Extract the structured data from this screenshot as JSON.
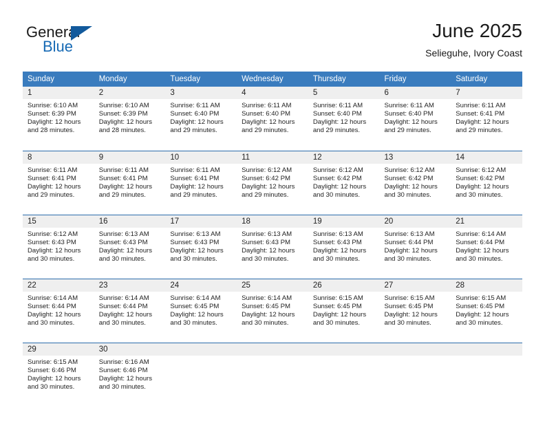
{
  "brand": {
    "name_part1": "General",
    "name_part2": "Blue",
    "triangle_color": "#125a9c",
    "blue_color": "#1569b4"
  },
  "header": {
    "title": "June 2025",
    "subtitle": "Selieguhe, Ivory Coast"
  },
  "colors": {
    "header_bg": "#3a7cbe",
    "daynum_bg": "#efefef",
    "row_divider": "#2b6cab",
    "text": "#222222"
  },
  "weekday_headers": [
    "Sunday",
    "Monday",
    "Tuesday",
    "Wednesday",
    "Thursday",
    "Friday",
    "Saturday"
  ],
  "weeks": [
    [
      {
        "day": "1",
        "sunrise": "Sunrise: 6:10 AM",
        "sunset": "Sunset: 6:39 PM",
        "daylight_line1": "Daylight: 12 hours",
        "daylight_line2": "and 28 minutes."
      },
      {
        "day": "2",
        "sunrise": "Sunrise: 6:10 AM",
        "sunset": "Sunset: 6:39 PM",
        "daylight_line1": "Daylight: 12 hours",
        "daylight_line2": "and 28 minutes."
      },
      {
        "day": "3",
        "sunrise": "Sunrise: 6:11 AM",
        "sunset": "Sunset: 6:40 PM",
        "daylight_line1": "Daylight: 12 hours",
        "daylight_line2": "and 29 minutes."
      },
      {
        "day": "4",
        "sunrise": "Sunrise: 6:11 AM",
        "sunset": "Sunset: 6:40 PM",
        "daylight_line1": "Daylight: 12 hours",
        "daylight_line2": "and 29 minutes."
      },
      {
        "day": "5",
        "sunrise": "Sunrise: 6:11 AM",
        "sunset": "Sunset: 6:40 PM",
        "daylight_line1": "Daylight: 12 hours",
        "daylight_line2": "and 29 minutes."
      },
      {
        "day": "6",
        "sunrise": "Sunrise: 6:11 AM",
        "sunset": "Sunset: 6:40 PM",
        "daylight_line1": "Daylight: 12 hours",
        "daylight_line2": "and 29 minutes."
      },
      {
        "day": "7",
        "sunrise": "Sunrise: 6:11 AM",
        "sunset": "Sunset: 6:41 PM",
        "daylight_line1": "Daylight: 12 hours",
        "daylight_line2": "and 29 minutes."
      }
    ],
    [
      {
        "day": "8",
        "sunrise": "Sunrise: 6:11 AM",
        "sunset": "Sunset: 6:41 PM",
        "daylight_line1": "Daylight: 12 hours",
        "daylight_line2": "and 29 minutes."
      },
      {
        "day": "9",
        "sunrise": "Sunrise: 6:11 AM",
        "sunset": "Sunset: 6:41 PM",
        "daylight_line1": "Daylight: 12 hours",
        "daylight_line2": "and 29 minutes."
      },
      {
        "day": "10",
        "sunrise": "Sunrise: 6:11 AM",
        "sunset": "Sunset: 6:41 PM",
        "daylight_line1": "Daylight: 12 hours",
        "daylight_line2": "and 29 minutes."
      },
      {
        "day": "11",
        "sunrise": "Sunrise: 6:12 AM",
        "sunset": "Sunset: 6:42 PM",
        "daylight_line1": "Daylight: 12 hours",
        "daylight_line2": "and 29 minutes."
      },
      {
        "day": "12",
        "sunrise": "Sunrise: 6:12 AM",
        "sunset": "Sunset: 6:42 PM",
        "daylight_line1": "Daylight: 12 hours",
        "daylight_line2": "and 30 minutes."
      },
      {
        "day": "13",
        "sunrise": "Sunrise: 6:12 AM",
        "sunset": "Sunset: 6:42 PM",
        "daylight_line1": "Daylight: 12 hours",
        "daylight_line2": "and 30 minutes."
      },
      {
        "day": "14",
        "sunrise": "Sunrise: 6:12 AM",
        "sunset": "Sunset: 6:42 PM",
        "daylight_line1": "Daylight: 12 hours",
        "daylight_line2": "and 30 minutes."
      }
    ],
    [
      {
        "day": "15",
        "sunrise": "Sunrise: 6:12 AM",
        "sunset": "Sunset: 6:43 PM",
        "daylight_line1": "Daylight: 12 hours",
        "daylight_line2": "and 30 minutes."
      },
      {
        "day": "16",
        "sunrise": "Sunrise: 6:13 AM",
        "sunset": "Sunset: 6:43 PM",
        "daylight_line1": "Daylight: 12 hours",
        "daylight_line2": "and 30 minutes."
      },
      {
        "day": "17",
        "sunrise": "Sunrise: 6:13 AM",
        "sunset": "Sunset: 6:43 PM",
        "daylight_line1": "Daylight: 12 hours",
        "daylight_line2": "and 30 minutes."
      },
      {
        "day": "18",
        "sunrise": "Sunrise: 6:13 AM",
        "sunset": "Sunset: 6:43 PM",
        "daylight_line1": "Daylight: 12 hours",
        "daylight_line2": "and 30 minutes."
      },
      {
        "day": "19",
        "sunrise": "Sunrise: 6:13 AM",
        "sunset": "Sunset: 6:43 PM",
        "daylight_line1": "Daylight: 12 hours",
        "daylight_line2": "and 30 minutes."
      },
      {
        "day": "20",
        "sunrise": "Sunrise: 6:13 AM",
        "sunset": "Sunset: 6:44 PM",
        "daylight_line1": "Daylight: 12 hours",
        "daylight_line2": "and 30 minutes."
      },
      {
        "day": "21",
        "sunrise": "Sunrise: 6:14 AM",
        "sunset": "Sunset: 6:44 PM",
        "daylight_line1": "Daylight: 12 hours",
        "daylight_line2": "and 30 minutes."
      }
    ],
    [
      {
        "day": "22",
        "sunrise": "Sunrise: 6:14 AM",
        "sunset": "Sunset: 6:44 PM",
        "daylight_line1": "Daylight: 12 hours",
        "daylight_line2": "and 30 minutes."
      },
      {
        "day": "23",
        "sunrise": "Sunrise: 6:14 AM",
        "sunset": "Sunset: 6:44 PM",
        "daylight_line1": "Daylight: 12 hours",
        "daylight_line2": "and 30 minutes."
      },
      {
        "day": "24",
        "sunrise": "Sunrise: 6:14 AM",
        "sunset": "Sunset: 6:45 PM",
        "daylight_line1": "Daylight: 12 hours",
        "daylight_line2": "and 30 minutes."
      },
      {
        "day": "25",
        "sunrise": "Sunrise: 6:14 AM",
        "sunset": "Sunset: 6:45 PM",
        "daylight_line1": "Daylight: 12 hours",
        "daylight_line2": "and 30 minutes."
      },
      {
        "day": "26",
        "sunrise": "Sunrise: 6:15 AM",
        "sunset": "Sunset: 6:45 PM",
        "daylight_line1": "Daylight: 12 hours",
        "daylight_line2": "and 30 minutes."
      },
      {
        "day": "27",
        "sunrise": "Sunrise: 6:15 AM",
        "sunset": "Sunset: 6:45 PM",
        "daylight_line1": "Daylight: 12 hours",
        "daylight_line2": "and 30 minutes."
      },
      {
        "day": "28",
        "sunrise": "Sunrise: 6:15 AM",
        "sunset": "Sunset: 6:45 PM",
        "daylight_line1": "Daylight: 12 hours",
        "daylight_line2": "and 30 minutes."
      }
    ],
    [
      {
        "day": "29",
        "sunrise": "Sunrise: 6:15 AM",
        "sunset": "Sunset: 6:46 PM",
        "daylight_line1": "Daylight: 12 hours",
        "daylight_line2": "and 30 minutes."
      },
      {
        "day": "30",
        "sunrise": "Sunrise: 6:16 AM",
        "sunset": "Sunset: 6:46 PM",
        "daylight_line1": "Daylight: 12 hours",
        "daylight_line2": "and 30 minutes."
      },
      {
        "day": "",
        "sunrise": "",
        "sunset": "",
        "daylight_line1": "",
        "daylight_line2": ""
      },
      {
        "day": "",
        "sunrise": "",
        "sunset": "",
        "daylight_line1": "",
        "daylight_line2": ""
      },
      {
        "day": "",
        "sunrise": "",
        "sunset": "",
        "daylight_line1": "",
        "daylight_line2": ""
      },
      {
        "day": "",
        "sunrise": "",
        "sunset": "",
        "daylight_line1": "",
        "daylight_line2": ""
      },
      {
        "day": "",
        "sunrise": "",
        "sunset": "",
        "daylight_line1": "",
        "daylight_line2": ""
      }
    ]
  ]
}
